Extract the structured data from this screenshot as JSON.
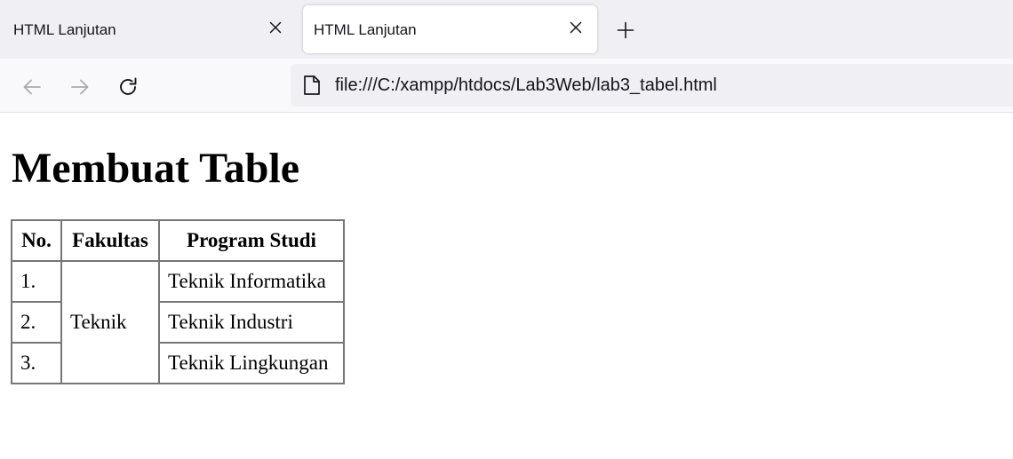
{
  "browser": {
    "tabs": [
      {
        "title": "HTML Lanjutan",
        "active": false
      },
      {
        "title": "HTML Lanjutan",
        "active": true
      }
    ],
    "address_bar": {
      "url": "file:///C:/xampp/htdocs/Lab3Web/lab3_tabel.html"
    },
    "icons": {
      "tab_close": "close-icon",
      "new_tab": "plus-icon",
      "back": "arrow-left-icon",
      "forward": "arrow-right-icon",
      "reload": "reload-icon",
      "page": "page-icon"
    }
  },
  "page": {
    "heading": "Membuat Table",
    "table": {
      "headers": [
        "No.",
        "Fakultas",
        "Program Studi"
      ],
      "faculty": "Teknik",
      "rows": [
        {
          "no": "1.",
          "program": "Teknik Informatika"
        },
        {
          "no": "2.",
          "program": "Teknik Industri"
        },
        {
          "no": "3.",
          "program": "Teknik Lingkungan"
        }
      ]
    }
  },
  "colors": {
    "tab_strip_bg": "#f0f0f4",
    "active_tab_bg": "#ffffff",
    "nav_bar_bg": "#f9f9fb",
    "url_bar_bg": "#f0f0f4",
    "text": "#15141a",
    "disabled_icon": "#a9a9b0",
    "table_border": "#767676"
  }
}
